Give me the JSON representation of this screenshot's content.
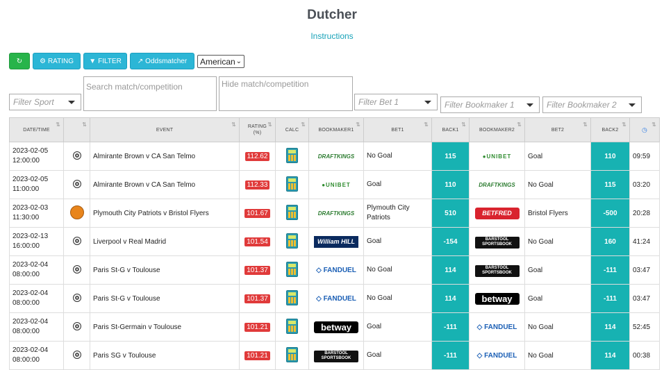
{
  "header": {
    "title": "Dutcher",
    "instructions_link": "Instructions"
  },
  "toolbar": {
    "refresh_icon": "refresh-icon",
    "rating_label": "RATING",
    "filter_label": "FILTER",
    "oddsmatcher_label": "Oddsmatcher",
    "odds_format": "American"
  },
  "filters": {
    "sport_placeholder": "Filter Sport",
    "search_placeholder": "Search match/competition",
    "hide_placeholder": "Hide match/competition",
    "bet1_placeholder": "Filter Bet 1",
    "bookmaker1_placeholder": "Filter Bookmaker 1",
    "bookmaker2_placeholder": "Filter Bookmaker 2"
  },
  "table": {
    "headers": [
      "DATE/TIME",
      "",
      "EVENT",
      "RATING (%)",
      "CALC",
      "BOOKMAKER1",
      "BET1",
      "BACK1",
      "BOOKMAKER2",
      "BET2",
      "BACK2",
      ""
    ],
    "rows": [
      {
        "date": "2023-02-05",
        "time": "12:00:00",
        "sport": "soccer",
        "event": "Almirante Brown v CA San Telmo",
        "rating": "112.62",
        "bk1": "DraftKings",
        "bet1": "No Goal",
        "back1": "115",
        "bk2": "Unibet",
        "bet2": "Goal",
        "back2": "110",
        "clock": "09:59"
      },
      {
        "date": "2023-02-05",
        "time": "11:00:00",
        "sport": "soccer",
        "event": "Almirante Brown v CA San Telmo",
        "rating": "112.33",
        "bk1": "Unibet",
        "bet1": "Goal",
        "back1": "110",
        "bk2": "DraftKings",
        "bet2": "No Goal",
        "back2": "115",
        "clock": "03:20"
      },
      {
        "date": "2023-02-03",
        "time": "11:30:00",
        "sport": "basketball",
        "event": "Plymouth City Patriots v Bristol Flyers",
        "rating": "101.67",
        "bk1": "DraftKings",
        "bet1": "Plymouth City Patriots",
        "back1": "510",
        "bk2": "Betfred",
        "bet2": "Bristol Flyers",
        "back2": "-500",
        "clock": "20:28"
      },
      {
        "date": "2023-02-13",
        "time": "16:00:00",
        "sport": "soccer",
        "event": "Liverpool v Real Madrid",
        "rating": "101.54",
        "bk1": "William Hill",
        "bet1": "Goal",
        "back1": "-154",
        "bk2": "Barstool",
        "bet2": "No Goal",
        "back2": "160",
        "clock": "41:24"
      },
      {
        "date": "2023-02-04",
        "time": "08:00:00",
        "sport": "soccer",
        "event": "Paris St-G v Toulouse",
        "rating": "101.37",
        "bk1": "FanDuel",
        "bet1": "No Goal",
        "back1": "114",
        "bk2": "Barstool",
        "bet2": "Goal",
        "back2": "-111",
        "clock": "03:47"
      },
      {
        "date": "2023-02-04",
        "time": "08:00:00",
        "sport": "soccer",
        "event": "Paris St-G v Toulouse",
        "rating": "101.37",
        "bk1": "FanDuel",
        "bet1": "No Goal",
        "back1": "114",
        "bk2": "betway",
        "bet2": "Goal",
        "back2": "-111",
        "clock": "03:47"
      },
      {
        "date": "2023-02-04",
        "time": "08:00:00",
        "sport": "soccer",
        "event": "Paris St-Germain v Toulouse",
        "rating": "101.21",
        "bk1": "betway",
        "bet1": "Goal",
        "back1": "-111",
        "bk2": "FanDuel",
        "bet2": "No Goal",
        "back2": "114",
        "clock": "52:45"
      },
      {
        "date": "2023-02-04",
        "time": "08:00:00",
        "sport": "soccer",
        "event": "Paris SG v Toulouse",
        "rating": "101.21",
        "bk1": "Barstool",
        "bet1": "Goal",
        "back1": "-111",
        "bk2": "FanDuel",
        "bet2": "No Goal",
        "back2": "114",
        "clock": "00:38"
      }
    ]
  },
  "colors": {
    "back_cell": "#17b2b2",
    "rating_badge": "#e03a3a",
    "refresh_btn": "#28b44a",
    "cyan_btn": "#2cb6d6"
  }
}
